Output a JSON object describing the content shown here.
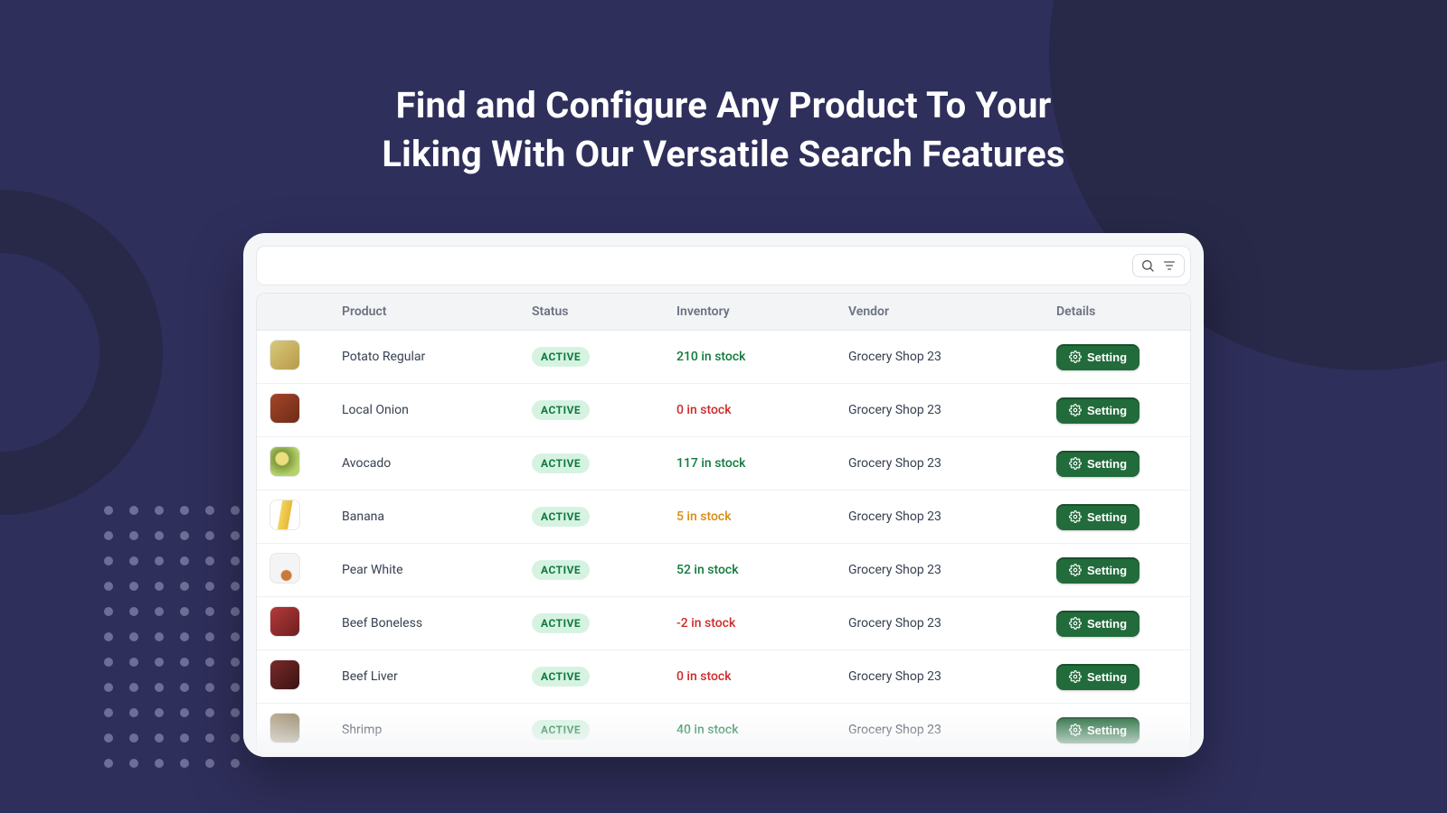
{
  "headline": {
    "line1": "Find and Configure Any Product To Your",
    "line2": "Liking With Our Versatile Search Features"
  },
  "columns": {
    "product": "Product",
    "status": "Status",
    "inventory": "Inventory",
    "vendor": "Vendor",
    "details": "Details"
  },
  "buttons": {
    "setting_label": "Setting"
  },
  "status_label": "ACTIVE",
  "rows": [
    {
      "name": "Potato Regular",
      "status": "ACTIVE",
      "inventory_text": "210 in stock",
      "inventory_level": "green",
      "vendor": "Grocery Shop 23",
      "thumb_bg": "linear-gradient(135deg,#d8c97a,#b89a4a)"
    },
    {
      "name": "Local Onion",
      "status": "ACTIVE",
      "inventory_text": "0 in stock",
      "inventory_level": "red",
      "vendor": "Grocery Shop 23",
      "thumb_bg": "linear-gradient(135deg,#a3452a,#6e2c17)"
    },
    {
      "name": "Avocado",
      "status": "ACTIVE",
      "inventory_text": "117 in stock",
      "inventory_level": "green",
      "vendor": "Grocery Shop 23",
      "thumb_bg": "radial-gradient(circle at 40% 40%, #eadf7c 25%, #7f9b3f 30%, #b6d26b 70%)"
    },
    {
      "name": "Banana",
      "status": "ACTIVE",
      "inventory_text": "5 in stock",
      "inventory_level": "orange",
      "vendor": "Grocery Shop 23",
      "thumb_bg": "linear-gradient(100deg,#ffffff 35%,#f3d35a 36%,#e6b93a 65%,#ffffff 66%)"
    },
    {
      "name": "Pear White",
      "status": "ACTIVE",
      "inventory_text": "52 in stock",
      "inventory_level": "green",
      "vendor": "Grocery Shop 23",
      "thumb_bg": "radial-gradient(circle at 55% 75%, #c97a3a 18%, #f4f4f4 22%)"
    },
    {
      "name": "Beef Boneless",
      "status": "ACTIVE",
      "inventory_text": "-2 in stock",
      "inventory_level": "red",
      "vendor": "Grocery Shop 23",
      "thumb_bg": "linear-gradient(135deg,#b53a3a,#6e1f1f)"
    },
    {
      "name": "Beef Liver",
      "status": "ACTIVE",
      "inventory_text": "0 in stock",
      "inventory_level": "red",
      "vendor": "Grocery Shop 23",
      "thumb_bg": "linear-gradient(135deg,#7a2a2a,#3b1212)"
    },
    {
      "name": "Shrimp",
      "status": "ACTIVE",
      "inventory_text": "40 in stock",
      "inventory_level": "green",
      "vendor": "Grocery Shop 23",
      "thumb_bg": "linear-gradient(135deg,#b7a98c,#8a7c60)"
    }
  ]
}
